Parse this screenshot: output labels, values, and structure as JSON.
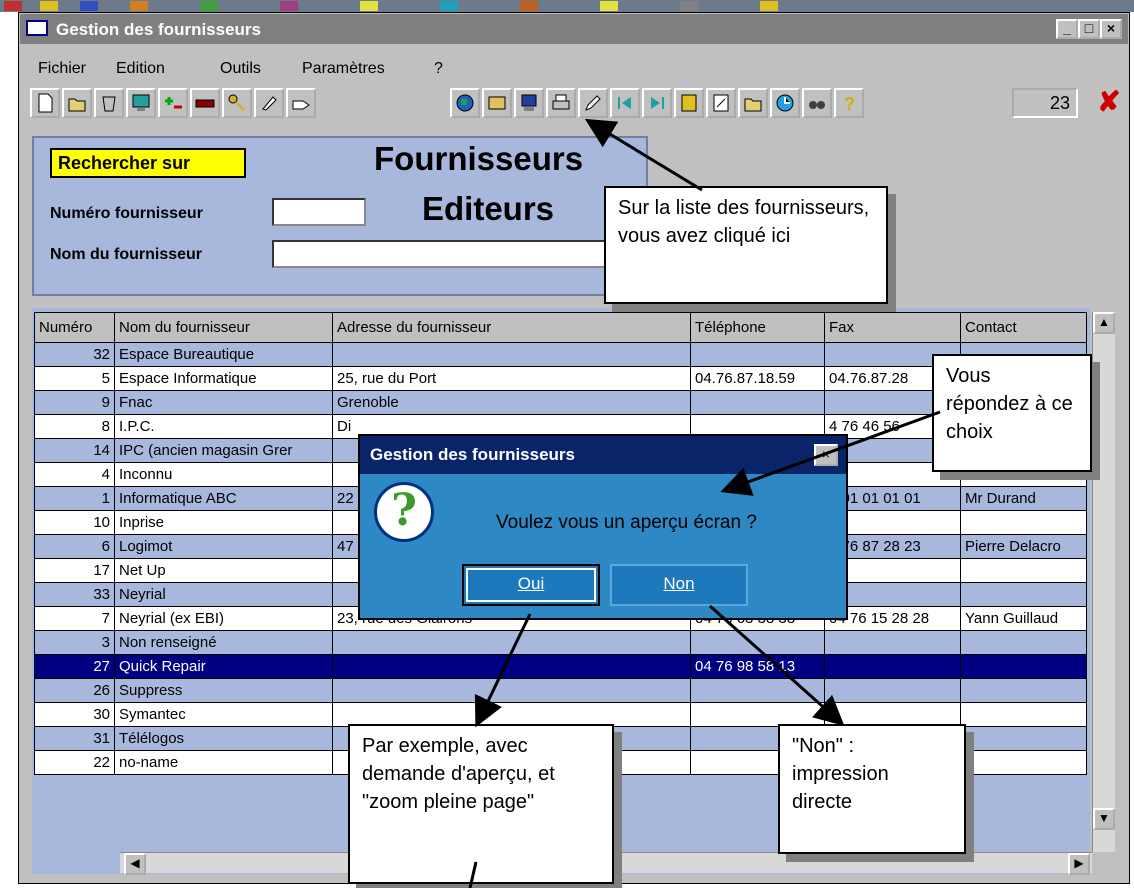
{
  "window": {
    "title": "Gestion des fournisseurs",
    "counter": "23"
  },
  "menu": {
    "fichier": "Fichier",
    "edition": "Edition",
    "outils": "Outils",
    "parametres": "Paramètres",
    "help": "?"
  },
  "search": {
    "rechercher_label": "Rechercher sur",
    "numero_label": "Numéro fournisseur",
    "nom_label": "Nom du fournisseur",
    "numero_value": "",
    "nom_value": ""
  },
  "header": {
    "title1": "Fournisseurs",
    "title2": "Editeurs"
  },
  "table": {
    "columns": [
      "Numéro",
      "Nom du fournisseur",
      "Adresse du fournisseur",
      "Téléphone",
      "Fax",
      "Contact"
    ],
    "rows": [
      [
        "32",
        "Espace Bureautique",
        "",
        "",
        "",
        ""
      ],
      [
        "5",
        "Espace Informatique",
        "25, rue du Port",
        "04.76.87.18.59",
        "04.76.87.28",
        ""
      ],
      [
        "9",
        "Fnac",
        "Grenoble",
        "",
        "",
        ""
      ],
      [
        "8",
        "I.P.C.",
        "Di",
        "",
        "4 76 46 56",
        ""
      ],
      [
        "14",
        "IPC (ancien magasin Grer",
        "",
        "",
        "",
        ""
      ],
      [
        "4",
        "Inconnu",
        "",
        "",
        "",
        ""
      ],
      [
        "1",
        "Informatique ABC",
        "22",
        "",
        "2 01 01 01 01",
        "Mr Durand"
      ],
      [
        "10",
        "Inprise",
        "",
        "",
        "",
        ""
      ],
      [
        "6",
        "Logimot",
        "47",
        "",
        "4 76 87 28 23",
        "Pierre Delacro"
      ],
      [
        "17",
        "Net Up",
        "",
        "",
        "",
        ""
      ],
      [
        "33",
        "Neyrial",
        "",
        "",
        "",
        ""
      ],
      [
        "7",
        "Neyrial (ex EBI)",
        "23, rue des Glairons",
        "04 76 63 38 38",
        "04 76 15 28 28",
        "Yann Guillaud"
      ],
      [
        "3",
        "Non renseigné",
        "",
        "",
        "",
        ""
      ],
      [
        "27",
        "Quick Repair",
        "",
        "04 76 98 58 13",
        "",
        ""
      ],
      [
        "26",
        "Suppress",
        "",
        "",
        "",
        ""
      ],
      [
        "30",
        "Symantec",
        "",
        "",
        "",
        ""
      ],
      [
        "31",
        "Télélogos",
        "",
        "",
        "",
        ""
      ],
      [
        "22",
        "no-name",
        "",
        "",
        "",
        ""
      ]
    ]
  },
  "dialog": {
    "title": "Gestion des fournisseurs",
    "message": "Voulez vous un aperçu écran ?",
    "oui": "Oui",
    "non": "Non"
  },
  "callouts": {
    "c1": "Sur la liste des fournisseurs, vous avez cliqué ici",
    "c2": "Vous répondez à ce choix",
    "c3": "Par exemple, avec demande d'aperçu, et \"zoom pleine page\"",
    "c4": "\"Non\" : impression directe"
  }
}
